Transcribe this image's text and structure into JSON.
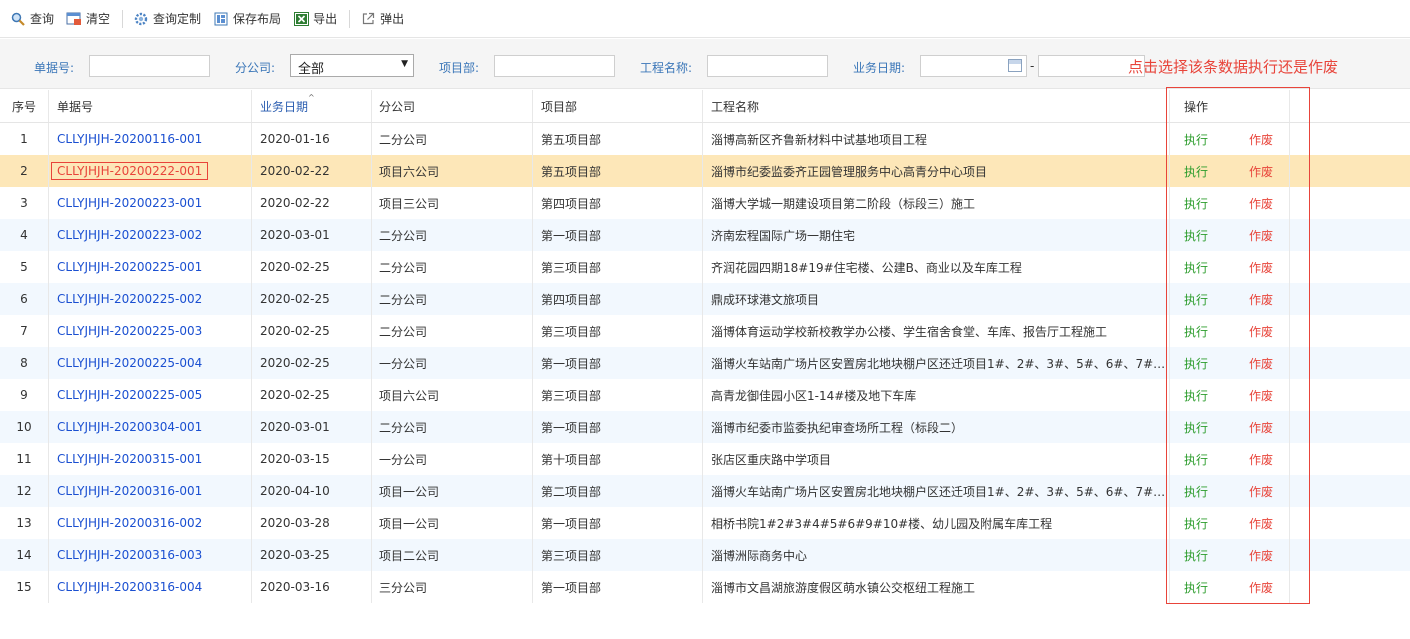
{
  "toolbar": {
    "query": "查询",
    "clear": "清空",
    "custom_query": "查询定制",
    "save_layout": "保存布局",
    "export": "导出",
    "popup": "弹出"
  },
  "filter": {
    "doc_no_label": "单据号:",
    "doc_no_value": "",
    "branch_label": "分公司:",
    "branch_selected": "全部",
    "project_dept_label": "项目部:",
    "project_dept_value": "",
    "project_name_label": "工程名称:",
    "project_name_value": "",
    "biz_date_label": "业务日期:",
    "date_from": "",
    "date_sep": "-",
    "date_to": ""
  },
  "annotation": "点击选择该条数据执行还是作废",
  "columns": {
    "index": "序号",
    "doc_no": "单据号",
    "biz_date": "业务日期",
    "branch": "分公司",
    "project_dept": "项目部",
    "project_name": "工程名称",
    "ops": "操作"
  },
  "ops_labels": {
    "execute": "执行",
    "void": "作废"
  },
  "rows": [
    {
      "idx": "1",
      "doc": "CLLYJHJH-20200116-001",
      "date": "2020-01-16",
      "branch": "二分公司",
      "dept": "第五项目部",
      "name": "淄博高新区齐鲁新材料中试基地项目工程"
    },
    {
      "idx": "2",
      "doc": "CLLYJHJH-20200222-001",
      "date": "2020-02-22",
      "branch": "项目六公司",
      "dept": "第五项目部",
      "name": "淄博市纪委监委齐正园管理服务中心高青分中心项目"
    },
    {
      "idx": "3",
      "doc": "CLLYJHJH-20200223-001",
      "date": "2020-02-22",
      "branch": "项目三公司",
      "dept": "第四项目部",
      "name": "淄博大学城一期建设项目第二阶段（标段三）施工"
    },
    {
      "idx": "4",
      "doc": "CLLYJHJH-20200223-002",
      "date": "2020-03-01",
      "branch": "二分公司",
      "dept": "第一项目部",
      "name": "济南宏程国际广场一期住宅"
    },
    {
      "idx": "5",
      "doc": "CLLYJHJH-20200225-001",
      "date": "2020-02-25",
      "branch": "二分公司",
      "dept": "第三项目部",
      "name": "齐润花园四期18#19#住宅楼、公建B、商业以及车库工程"
    },
    {
      "idx": "6",
      "doc": "CLLYJHJH-20200225-002",
      "date": "2020-02-25",
      "branch": "二分公司",
      "dept": "第四项目部",
      "name": "鼎成环球港文旅项目"
    },
    {
      "idx": "7",
      "doc": "CLLYJHJH-20200225-003",
      "date": "2020-02-25",
      "branch": "二分公司",
      "dept": "第三项目部",
      "name": "淄博体育运动学校新校教学办公楼、学生宿舍食堂、车库、报告厅工程施工"
    },
    {
      "idx": "8",
      "doc": "CLLYJHJH-20200225-004",
      "date": "2020-02-25",
      "branch": "一分公司",
      "dept": "第一项目部",
      "name": "淄博火车站南广场片区安置房北地块棚户区还迁项目1#、2#、3#、5#、6#、7#、8..."
    },
    {
      "idx": "9",
      "doc": "CLLYJHJH-20200225-005",
      "date": "2020-02-25",
      "branch": "项目六公司",
      "dept": "第三项目部",
      "name": "高青龙御佳园小区1-14#楼及地下车库"
    },
    {
      "idx": "10",
      "doc": "CLLYJHJH-20200304-001",
      "date": "2020-03-01",
      "branch": "二分公司",
      "dept": "第一项目部",
      "name": "淄博市纪委市监委执纪审查场所工程（标段二）"
    },
    {
      "idx": "11",
      "doc": "CLLYJHJH-20200315-001",
      "date": "2020-03-15",
      "branch": "一分公司",
      "dept": "第十项目部",
      "name": "张店区重庆路中学项目"
    },
    {
      "idx": "12",
      "doc": "CLLYJHJH-20200316-001",
      "date": "2020-04-10",
      "branch": "项目一公司",
      "dept": "第二项目部",
      "name": "淄博火车站南广场片区安置房北地块棚户区还迁项目1#、2#、3#、5#、6#、7#、8..."
    },
    {
      "idx": "13",
      "doc": "CLLYJHJH-20200316-002",
      "date": "2020-03-28",
      "branch": "项目一公司",
      "dept": "第一项目部",
      "name": "相桥书院1#2#3#4#5#6#9#10#楼、幼儿园及附属车库工程"
    },
    {
      "idx": "14",
      "doc": "CLLYJHJH-20200316-003",
      "date": "2020-03-25",
      "branch": "项目二公司",
      "dept": "第三项目部",
      "name": "淄博洲际商务中心"
    },
    {
      "idx": "15",
      "doc": "CLLYJHJH-20200316-004",
      "date": "2020-03-16",
      "branch": "三分公司",
      "dept": "第一项目部",
      "name": "淄博市文昌湖旅游度假区萌水镇公交枢纽工程施工"
    }
  ],
  "selected_row": "2",
  "colors": {
    "link": "#1a4fd1",
    "execute": "#2c9c2c",
    "void": "#e8443a",
    "selected_row": "#fde7b8",
    "stripe": "#f2f8fe",
    "label_blue": "#3a76b8"
  }
}
